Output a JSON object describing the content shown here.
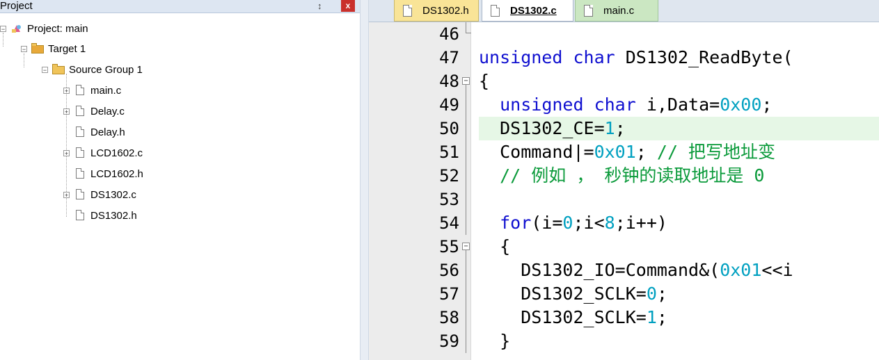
{
  "project_pane": {
    "title": "Project",
    "pin_glyph": "↕",
    "close_glyph": "x",
    "tree": [
      {
        "label": "Project: main",
        "icon": "project-icon",
        "expander": "−"
      },
      {
        "label": "Target 1",
        "icon": "target-icon",
        "expander": "−"
      },
      {
        "label": "Source Group 1",
        "icon": "folder-icon",
        "expander": "−"
      },
      {
        "label": "main.c",
        "icon": "file-icon",
        "expander": "+"
      },
      {
        "label": "Delay.c",
        "icon": "file-icon",
        "expander": "+"
      },
      {
        "label": "Delay.h",
        "icon": "file-icon",
        "expander": ""
      },
      {
        "label": "LCD1602.c",
        "icon": "file-icon",
        "expander": "+"
      },
      {
        "label": "LCD1602.h",
        "icon": "file-icon",
        "expander": ""
      },
      {
        "label": "DS1302.c",
        "icon": "file-icon",
        "expander": "+"
      },
      {
        "label": "DS1302.h",
        "icon": "file-icon",
        "expander": ""
      }
    ]
  },
  "tabs": [
    {
      "label": "DS1302.h",
      "active": false,
      "color": "#f9e497"
    },
    {
      "label": "DS1302.c",
      "active": true,
      "color": "#ffffff"
    },
    {
      "label": "main.c",
      "active": false,
      "color": "#cbe7c2"
    }
  ],
  "editor": {
    "highlight_color": "#e6f7e6",
    "colors": {
      "keyword": "#1010d0",
      "number": "#00a0c0",
      "comment": "#0a9a3a"
    },
    "lines": [
      {
        "number": "46",
        "fold": "end",
        "segments": []
      },
      {
        "number": "47",
        "fold": "",
        "segments": [
          {
            "t": "kw",
            "v": "unsigned char"
          },
          {
            "t": "",
            "v": " DS1302_ReadByte("
          }
        ]
      },
      {
        "number": "48",
        "fold": "open",
        "segments": [
          {
            "t": "",
            "v": "{"
          }
        ]
      },
      {
        "number": "49",
        "fold": "line",
        "segments": [
          {
            "t": "",
            "v": "  "
          },
          {
            "t": "kw",
            "v": "unsigned char"
          },
          {
            "t": "",
            "v": " i,Data="
          },
          {
            "t": "num",
            "v": "0x00"
          },
          {
            "t": "",
            "v": ";"
          }
        ]
      },
      {
        "number": "50",
        "fold": "line",
        "highlight": true,
        "segments": [
          {
            "t": "",
            "v": "  DS1302_CE="
          },
          {
            "t": "num",
            "v": "1"
          },
          {
            "t": "",
            "v": ";"
          }
        ]
      },
      {
        "number": "51",
        "fold": "line",
        "segments": [
          {
            "t": "",
            "v": "  Command|="
          },
          {
            "t": "num",
            "v": "0x01"
          },
          {
            "t": "",
            "v": "; "
          },
          {
            "t": "cm",
            "v": "// 把写地址变"
          }
        ]
      },
      {
        "number": "52",
        "fold": "line",
        "segments": [
          {
            "t": "",
            "v": "  "
          },
          {
            "t": "cm",
            "v": "// 例如 ， 秒钟的读取地址是 0"
          }
        ]
      },
      {
        "number": "53",
        "fold": "line",
        "segments": []
      },
      {
        "number": "54",
        "fold": "line",
        "segments": [
          {
            "t": "",
            "v": "  "
          },
          {
            "t": "kw",
            "v": "for"
          },
          {
            "t": "",
            "v": "(i="
          },
          {
            "t": "num",
            "v": "0"
          },
          {
            "t": "",
            "v": ";i<"
          },
          {
            "t": "num",
            "v": "8"
          },
          {
            "t": "",
            "v": ";i++)"
          }
        ]
      },
      {
        "number": "55",
        "fold": "open",
        "segments": [
          {
            "t": "",
            "v": "  {"
          }
        ]
      },
      {
        "number": "56",
        "fold": "line",
        "segments": [
          {
            "t": "",
            "v": "    DS1302_IO=Command&("
          },
          {
            "t": "num",
            "v": "0x01"
          },
          {
            "t": "",
            "v": "<<i"
          }
        ]
      },
      {
        "number": "57",
        "fold": "line",
        "segments": [
          {
            "t": "",
            "v": "    DS1302_SCLK="
          },
          {
            "t": "num",
            "v": "0"
          },
          {
            "t": "",
            "v": ";"
          }
        ]
      },
      {
        "number": "58",
        "fold": "line",
        "segments": [
          {
            "t": "",
            "v": "    DS1302_SCLK="
          },
          {
            "t": "num",
            "v": "1"
          },
          {
            "t": "",
            "v": ";"
          }
        ]
      },
      {
        "number": "59",
        "fold": "line",
        "segments": [
          {
            "t": "",
            "v": "  }"
          }
        ]
      }
    ]
  }
}
